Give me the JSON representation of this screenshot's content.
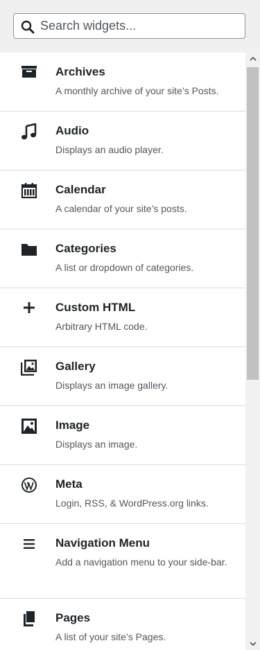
{
  "search": {
    "placeholder": "Search widgets..."
  },
  "widgets": [
    {
      "title": "Archives",
      "description": "A monthly archive of your site’s Posts.",
      "icon": "archive-icon"
    },
    {
      "title": "Audio",
      "description": "Displays an audio player.",
      "icon": "music-note-icon"
    },
    {
      "title": "Calendar",
      "description": "A calendar of your site’s posts.",
      "icon": "calendar-icon"
    },
    {
      "title": "Categories",
      "description": "A list or dropdown of categories.",
      "icon": "folder-icon"
    },
    {
      "title": "Custom HTML",
      "description": "Arbitrary HTML code.",
      "icon": "plus-icon"
    },
    {
      "title": "Gallery",
      "description": "Displays an image gallery.",
      "icon": "gallery-icon"
    },
    {
      "title": "Image",
      "description": "Displays an image.",
      "icon": "image-icon"
    },
    {
      "title": "Meta",
      "description": "Login, RSS, & WordPress.org links.",
      "icon": "wordpress-icon"
    },
    {
      "title": "Navigation Menu",
      "description": "Add a navigation menu to your side-bar.",
      "icon": "menu-icon"
    },
    {
      "title": "Pages",
      "description": "A list of your site’s Pages.",
      "icon": "pages-icon"
    }
  ],
  "colors": {
    "text": "#1d2327",
    "muted": "#50575e",
    "divider": "#dcdcde",
    "icon": "#1d2327"
  }
}
